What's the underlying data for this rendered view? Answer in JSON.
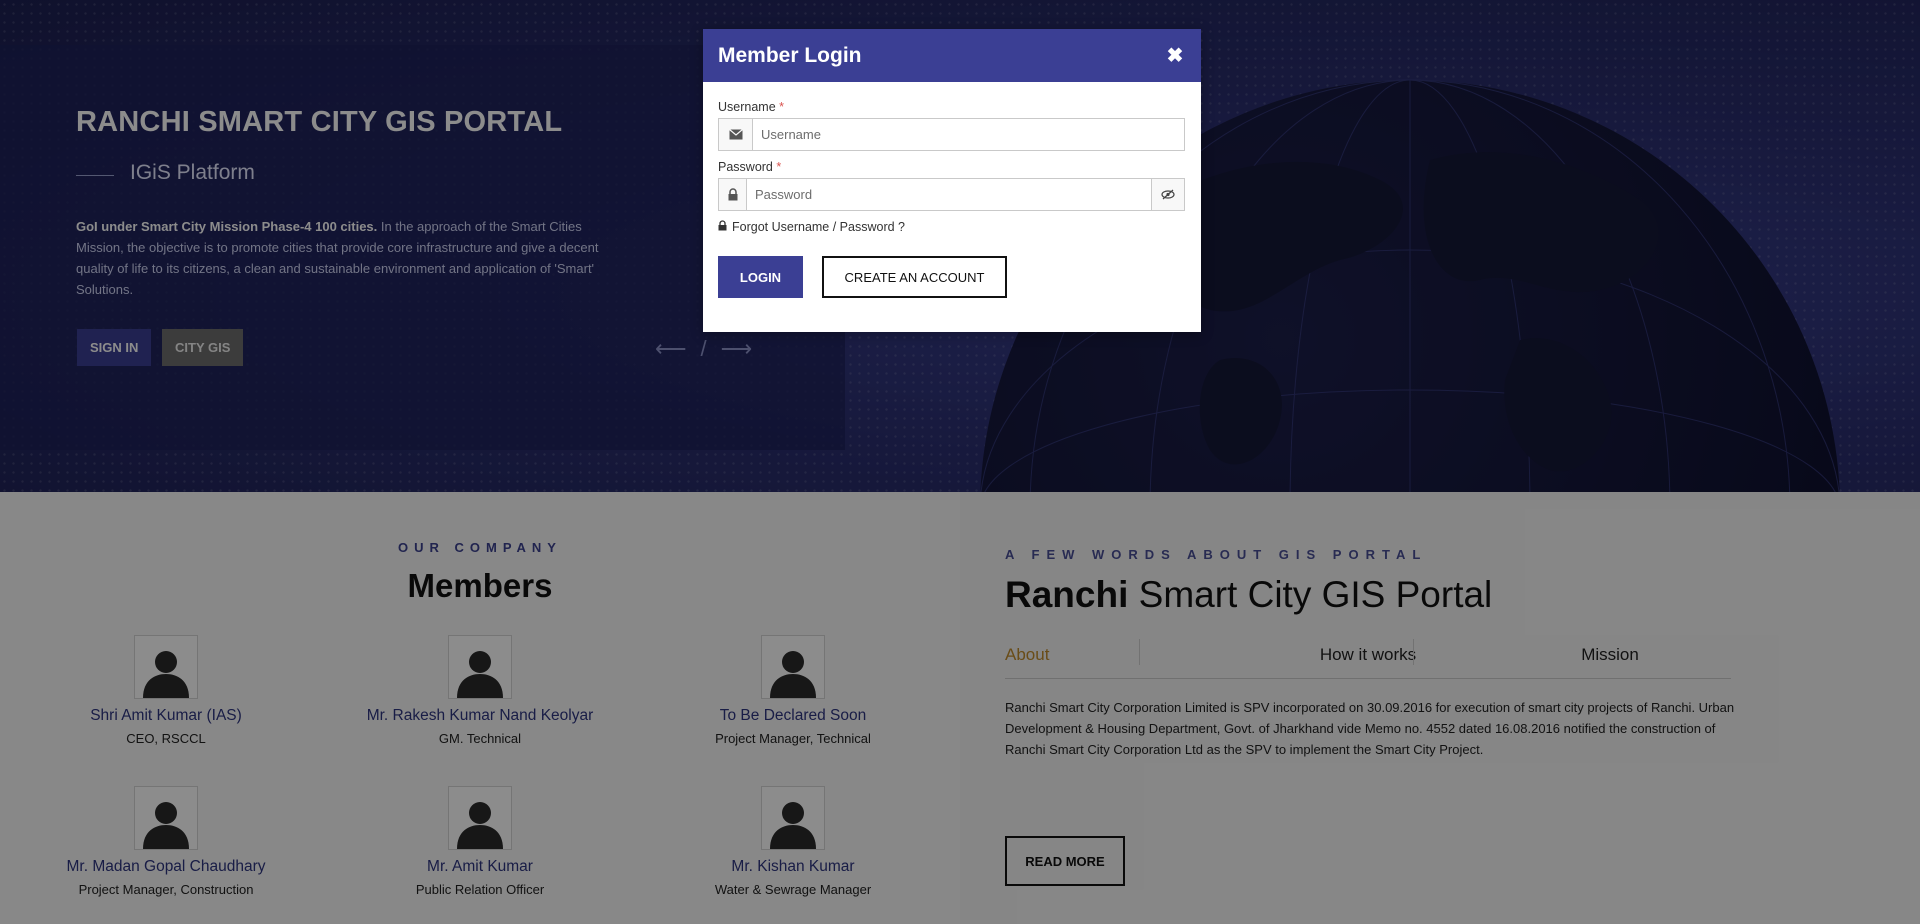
{
  "hero": {
    "title": "RANCHI SMART CITY GIS PORTAL",
    "subtitle": "IGiS Platform",
    "desc_bold": "GoI under Smart City Mission Phase-4 100 cities.",
    "desc_rest": " In the approach of the Smart Cities Mission, the objective is to promote cities that provide core infrastructure and give a decent quality of life to its citizens, a clean and sustainable environment and application of 'Smart' Solutions.",
    "sign_in": "SIGN IN",
    "city_gis": "CITY GIS",
    "prev_arrow": "⟵",
    "slash": "/",
    "next_arrow": "⟶"
  },
  "members_section": {
    "eyebrow": "OUR COMPANY",
    "title": "Members",
    "members": [
      {
        "name": "Shri Amit Kumar (IAS)",
        "role": "CEO, RSCCL"
      },
      {
        "name": "Mr. Rakesh Kumar Nand Keolyar",
        "role": "GM. Technical"
      },
      {
        "name": "To Be Declared Soon",
        "role": "Project Manager, Technical"
      },
      {
        "name": "Mr. Madan Gopal Chaudhary",
        "role": "Project Manager, Construction"
      },
      {
        "name": "Mr. Amit Kumar",
        "role": "Public Relation Officer"
      },
      {
        "name": "Mr. Kishan Kumar",
        "role": "Water & Sewrage Manager"
      }
    ]
  },
  "about_section": {
    "eyebrow": "A FEW WORDS ABOUT GIS PORTAL",
    "title_bold": "Ranchi",
    "title_rest": " Smart City GIS Portal",
    "tabs": [
      "About",
      "How it works",
      "Mission"
    ],
    "active_tab": "About",
    "text": "Ranchi Smart City Corporation Limited is SPV incorporated on 30.09.2016 for execution of smart city projects of Ranchi. Urban Development & Housing Department, Govt. of Jharkhand vide Memo no. 4552 dated 16.08.2016 notified the construction of Ranchi Smart City Corporation Ltd as the SPV to implement the Smart City Project.",
    "read_more": "READ MORE"
  },
  "modal": {
    "title": "Member Login",
    "close": "✖",
    "username_label": "Username",
    "username_placeholder": "Username",
    "username_value": "",
    "password_label": "Password",
    "password_placeholder": "Password",
    "password_value": "",
    "required_mark": "*",
    "forgot": "Forgot Username / Password ?",
    "login": "LOGIN",
    "create_account": "CREATE AN ACCOUNT"
  },
  "colors": {
    "brand": "#3b3f94",
    "active_tab": "#c08a2a",
    "member_name": "#2e3580"
  },
  "icons": [
    "close-icon",
    "envelope-icon",
    "lock-icon",
    "eye-slash-icon",
    "lock-small-icon",
    "avatar-icon",
    "globe-graphic"
  ]
}
